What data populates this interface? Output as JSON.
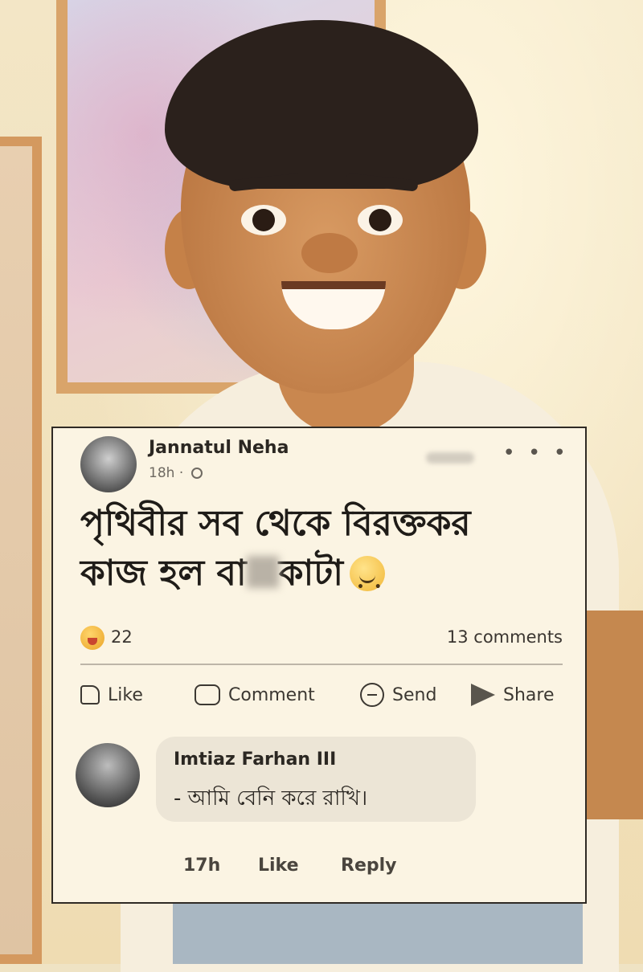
{
  "post": {
    "author": "Jannatul Neha",
    "time": "18h",
    "separator": "·",
    "text_line1": "পৃথিবীর সব থেকে বিরক্তকর",
    "text_line2_before": "কাজ হল বা",
    "text_line2_after": "কাটা",
    "reaction_count": "22",
    "comment_count": "13 comments"
  },
  "actions": {
    "like": "Like",
    "comment": "Comment",
    "send": "Send",
    "share": "Share"
  },
  "comment": {
    "author": "Imtiaz Farhan III",
    "text": "- আমি বেনি করে রাখি।",
    "time": "17h",
    "like": "Like",
    "reply": "Reply"
  },
  "icons": {
    "more": "more-options-icon",
    "audience": "globe-icon",
    "reaction": "laughing-emoji-icon",
    "post_emoji": "smiley-emoji-icon"
  }
}
